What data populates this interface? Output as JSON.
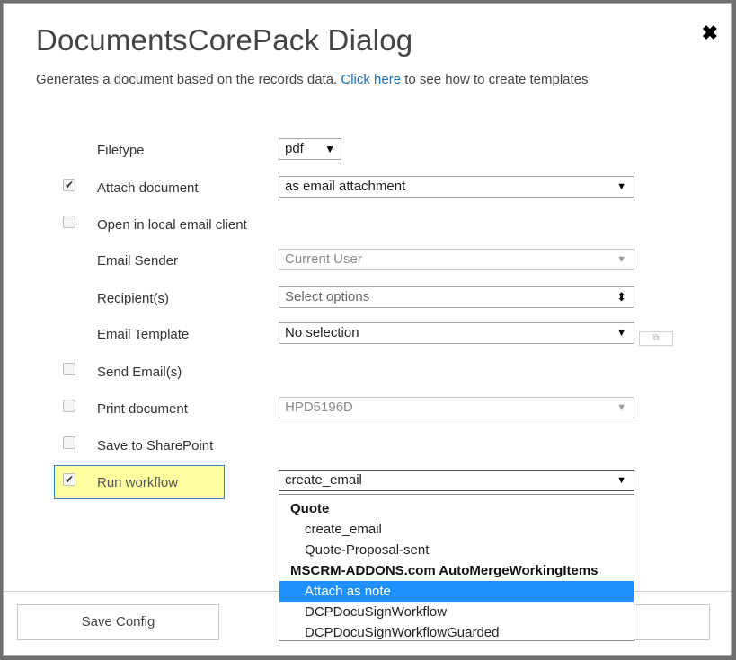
{
  "dialog": {
    "title": "DocumentsCorePack Dialog",
    "close_glyph": "✖",
    "subtitle_before": "Generates a document based on the records data.",
    "subtitle_link": "Click here",
    "subtitle_after": "to see how to create templates"
  },
  "form": {
    "filetype": {
      "label": "Filetype",
      "value": "pdf"
    },
    "attach_document": {
      "label": "Attach document",
      "checked": true,
      "value": "as email attachment"
    },
    "open_local_email": {
      "label": "Open in local email client",
      "checked": false
    },
    "email_sender": {
      "label": "Email Sender",
      "value": "Current User",
      "disabled": true
    },
    "recipients": {
      "label": "Recipient(s)",
      "placeholder": "Select options"
    },
    "email_template": {
      "label": "Email Template",
      "value": "No selection"
    },
    "send_emails": {
      "label": "Send Email(s)",
      "checked": false
    },
    "print_document": {
      "label": "Print document",
      "checked": false,
      "value": "HPD5196D",
      "disabled": true
    },
    "save_sharepoint": {
      "label": "Save to SharePoint",
      "checked": false
    },
    "run_workflow": {
      "label": "Run workflow",
      "checked": true,
      "value": "create_email"
    }
  },
  "glyphs": {
    "check": "✔",
    "arrow_down": "▼",
    "updown": "⬍",
    "external": "⧉"
  },
  "workflow_dropdown": {
    "items": [
      {
        "type": "group",
        "label": "Quote"
      },
      {
        "type": "option",
        "label": "create_email"
      },
      {
        "type": "option",
        "label": "Quote-Proposal-sent"
      },
      {
        "type": "group",
        "label": "MSCRM-ADDONS.com AutoMergeWorkingItems"
      },
      {
        "type": "option",
        "label": "Attach as note",
        "selected": true
      },
      {
        "type": "option",
        "label": "DCPDocuSignWorkflow"
      },
      {
        "type": "option",
        "label": "DCPDocuSignWorkflowGuarded"
      }
    ]
  },
  "footer": {
    "save_config_label": "Save Config"
  },
  "colors": {
    "link": "#1a6fb8",
    "highlight": "#ffffa0",
    "selected_option": "#1e90ff"
  }
}
